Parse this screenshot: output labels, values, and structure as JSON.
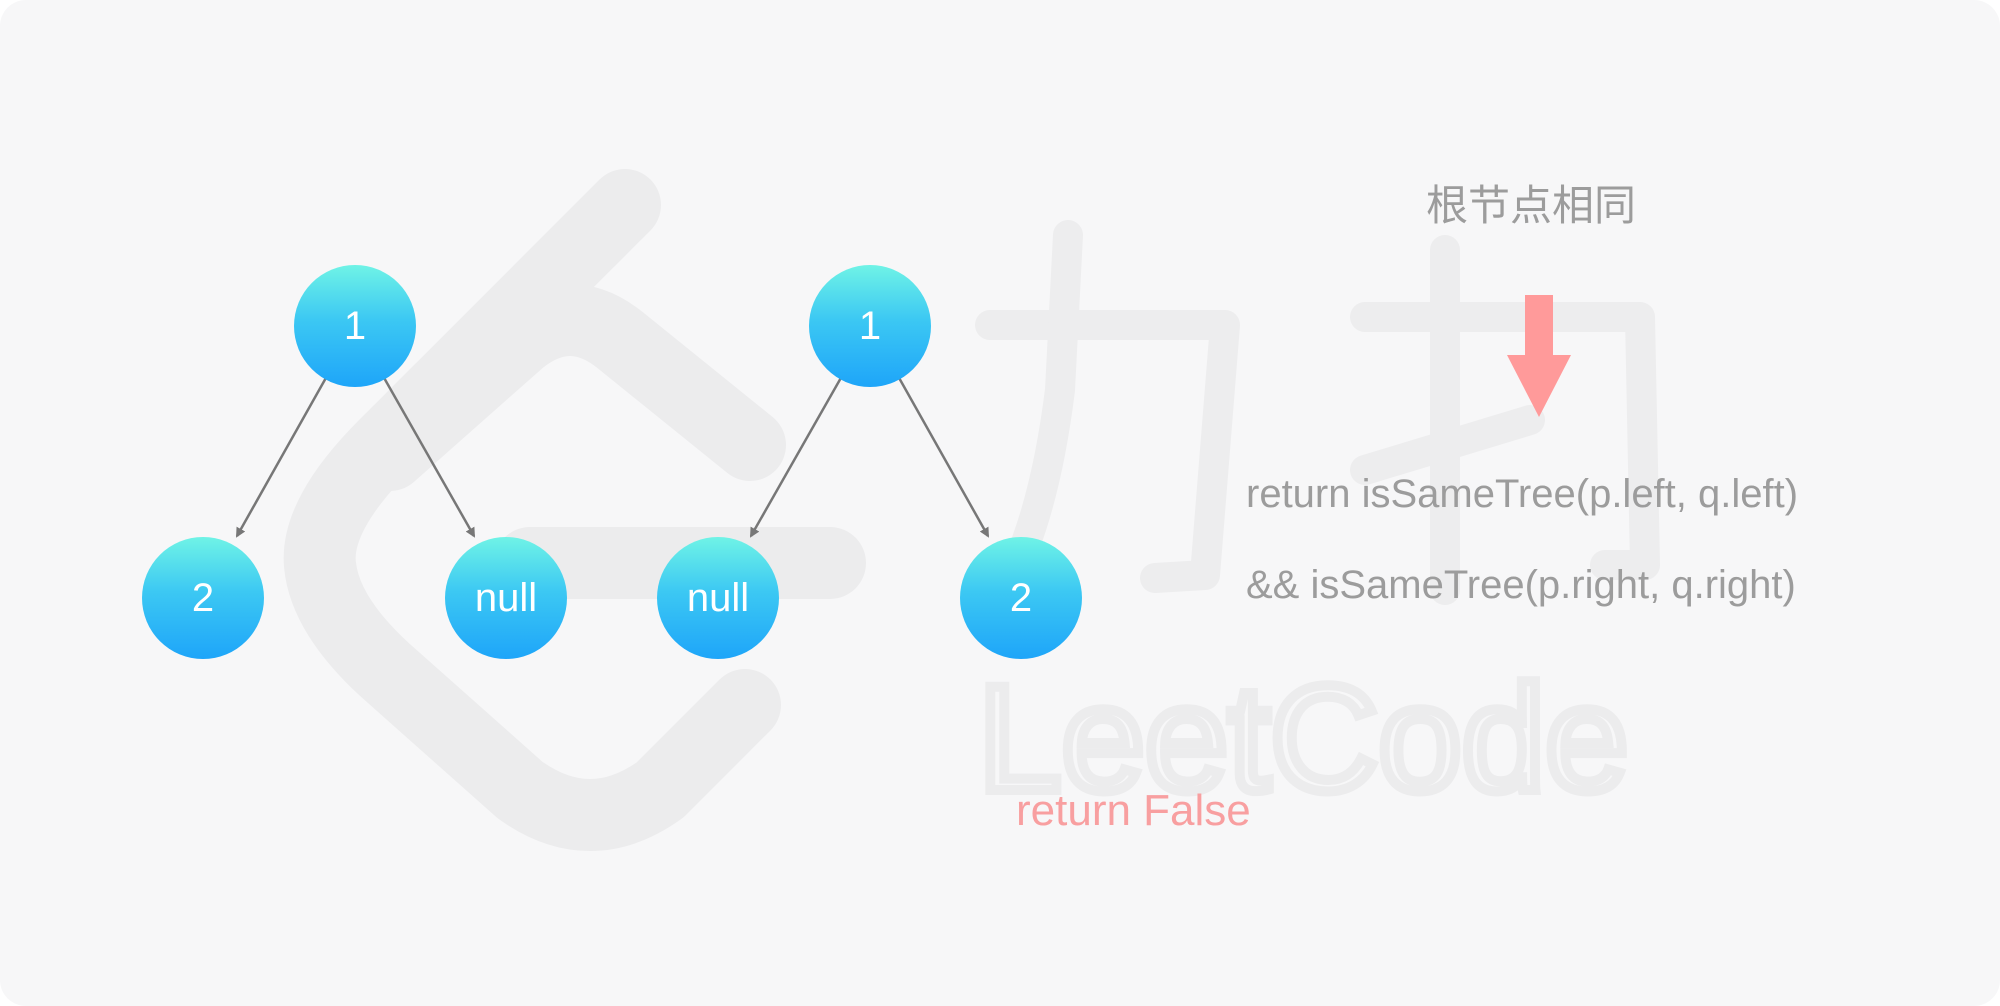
{
  "tree_left": {
    "root": "1",
    "left_child": "2",
    "right_child": "null"
  },
  "tree_right": {
    "root": "1",
    "left_child": "null",
    "right_child": "2"
  },
  "annotation": {
    "heading": "根节点相同",
    "code_line_1": "return isSameTree(p.left, q.left)",
    "code_line_2": "&& isSameTree(p.right, q.right)",
    "result": "return False"
  },
  "watermark": {
    "brand_text": "LeetCode",
    "chinese_text": "力扣"
  },
  "colors": {
    "node_top": "#6ff3e6",
    "node_bottom": "#1ea5f9",
    "edge": "#777777",
    "arrow_down": "#ff9a9a",
    "result": "#f89fa0",
    "annotation": "#9c9c9c"
  },
  "icons": {
    "down_arrow": "arrow-down-icon"
  }
}
